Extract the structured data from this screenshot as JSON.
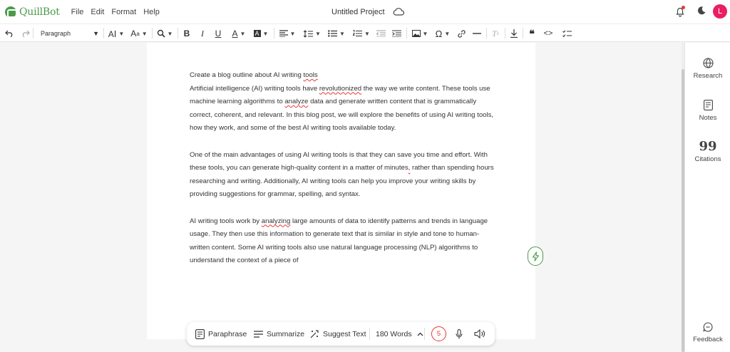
{
  "app": {
    "logo_text": "QuillBot",
    "brand_color": "#4a9b4a",
    "menu": [
      "File",
      "Edit",
      "Format",
      "Help"
    ],
    "project_title": "Untitled Project",
    "avatar_initial": "L",
    "avatar_color": "#e91e63"
  },
  "toolbar": {
    "paragraph_style": "Paragraph",
    "icons": [
      "undo-icon",
      "redo-icon",
      "font-size-icon",
      "font-style-icon",
      "find-replace-icon",
      "bold-icon",
      "italic-icon",
      "underline-icon",
      "text-color-icon",
      "highlight-icon",
      "align-icon",
      "line-height-icon",
      "bullet-list-icon",
      "numbered-list-icon",
      "outdent-icon",
      "indent-icon",
      "image-icon",
      "special-char-icon",
      "link-icon",
      "horizontal-rule-icon",
      "clear-format-icon",
      "download-icon",
      "quote-icon",
      "code-icon",
      "checklist-icon"
    ]
  },
  "document": {
    "title_line": "Create a blog outline about AI writing tools",
    "paragraphs": [
      " Artificial intelligence (AI) writing tools have revolutionized the way we write content. These tools use machine learning algorithms to analyze data and generate written content that is grammatically correct, coherent, and relevant. In this blog post, we will explore the benefits of using AI writing tools, how they work, and some of the best AI writing tools available today.",
      "One of the main advantages of using AI writing tools is that they can save you time and effort. With these tools, you can generate high-quality content in a matter of minutes, rather than spending hours researching and writing. Additionally, AI writing tools can help you improve your writing skills by providing suggestions for grammar, spelling, and syntax.",
      "AI writing tools work by analyzing large amounts of data to identify patterns and trends in language usage. They then use this information to generate text that is similar in style and tone to human-written content. Some AI writing tools also use natural language processing (NLP) algorithms to understand the context of a piece of"
    ]
  },
  "bottom_bar": {
    "paraphrase": "Paraphrase",
    "summarize": "Summarize",
    "suggest": "Suggest Text",
    "word_count": "180 Words",
    "issues": "5"
  },
  "right_panel": {
    "research": "Research",
    "notes": "Notes",
    "citations": "Citations",
    "feedback": "Feedback"
  }
}
